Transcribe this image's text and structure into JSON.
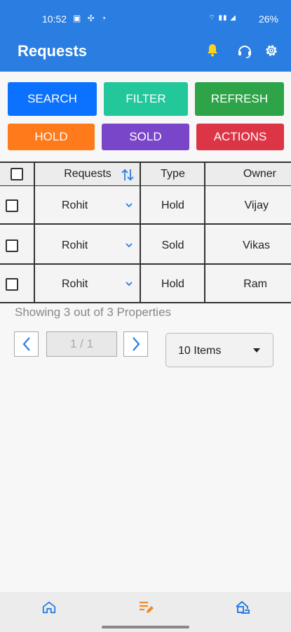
{
  "status_bar": {
    "time": "10:52",
    "battery": "26%"
  },
  "header": {
    "title": "Requests"
  },
  "toolbar": {
    "search": "SEARCH",
    "filter": "FILTER",
    "refresh": "REFRESH",
    "hold": "HOLD",
    "sold": "SOLD",
    "actions": "ACTIONS"
  },
  "table": {
    "headers": {
      "requests": "Requests",
      "type": "Type",
      "owner": "Owner"
    },
    "rows": [
      {
        "request": "Rohit",
        "type": "Hold",
        "owner": "Vijay"
      },
      {
        "request": "Rohit",
        "type": "Sold",
        "owner": "Vikas"
      },
      {
        "request": "Rohit",
        "type": "Hold",
        "owner": "Ram"
      }
    ]
  },
  "pagination": {
    "summary": "Showing 3 out of 3 Properties",
    "page": "1 / 1",
    "page_size": "10 Items"
  },
  "colors": {
    "appbar": "#2a7de1",
    "search": "#0a72ff",
    "filter": "#22c79a",
    "refresh": "#2ca447",
    "hold": "#ff7a1a",
    "sold": "#7a46c9",
    "actions": "#dc3545",
    "bell": "#ffd21a",
    "active_nav": "#f08a2a"
  },
  "icons": [
    "bell-icon",
    "headset-icon",
    "gear-icon",
    "sort-icon",
    "chevron-down-icon",
    "chevron-left-icon",
    "chevron-right-icon",
    "home-icon",
    "requests-icon",
    "properties-icon"
  ]
}
